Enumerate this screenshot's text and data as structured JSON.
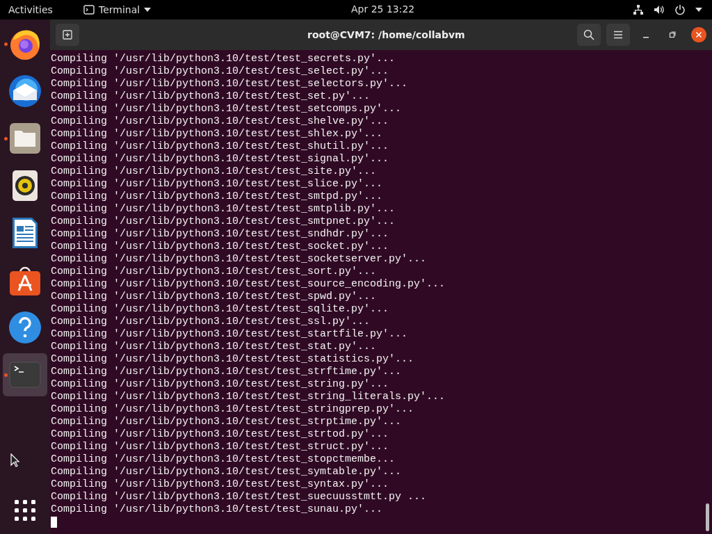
{
  "top_bar": {
    "activities": "Activities",
    "app_menu": "Terminal",
    "clock": "Apr 25  13:22"
  },
  "dock": {
    "items": [
      {
        "kind": "firefox",
        "running": true,
        "selected": false
      },
      {
        "kind": "thunderbird",
        "running": false,
        "selected": false
      },
      {
        "kind": "files",
        "running": true,
        "selected": false
      },
      {
        "kind": "rhythmbox",
        "running": false,
        "selected": false
      },
      {
        "kind": "writer",
        "running": false,
        "selected": false
      },
      {
        "kind": "software",
        "running": false,
        "selected": false
      },
      {
        "kind": "help",
        "running": false,
        "selected": false
      },
      {
        "kind": "terminal",
        "running": true,
        "selected": true
      }
    ]
  },
  "window": {
    "title": "root@CVM7: /home/collabvm"
  },
  "terminal": {
    "lines": [
      "Compiling '/usr/lib/python3.10/test/test_secrets.py'...",
      "Compiling '/usr/lib/python3.10/test/test_select.py'...",
      "Compiling '/usr/lib/python3.10/test/test_selectors.py'...",
      "Compiling '/usr/lib/python3.10/test/test_set.py'...",
      "Compiling '/usr/lib/python3.10/test/test_setcomps.py'...",
      "Compiling '/usr/lib/python3.10/test/test_shelve.py'...",
      "Compiling '/usr/lib/python3.10/test/test_shlex.py'...",
      "Compiling '/usr/lib/python3.10/test/test_shutil.py'...",
      "Compiling '/usr/lib/python3.10/test/test_signal.py'...",
      "Compiling '/usr/lib/python3.10/test/test_site.py'...",
      "Compiling '/usr/lib/python3.10/test/test_slice.py'...",
      "Compiling '/usr/lib/python3.10/test/test_smtpd.py'...",
      "Compiling '/usr/lib/python3.10/test/test_smtplib.py'...",
      "Compiling '/usr/lib/python3.10/test/test_smtpnet.py'...",
      "Compiling '/usr/lib/python3.10/test/test_sndhdr.py'...",
      "Compiling '/usr/lib/python3.10/test/test_socket.py'...",
      "Compiling '/usr/lib/python3.10/test/test_socketserver.py'...",
      "Compiling '/usr/lib/python3.10/test/test_sort.py'...",
      "Compiling '/usr/lib/python3.10/test/test_source_encoding.py'...",
      "Compiling '/usr/lib/python3.10/test/test_spwd.py'...",
      "Compiling '/usr/lib/python3.10/test/test_sqlite.py'...",
      "Compiling '/usr/lib/python3.10/test/test_ssl.py'...",
      "Compiling '/usr/lib/python3.10/test/test_startfile.py'...",
      "Compiling '/usr/lib/python3.10/test/test_stat.py'...",
      "Compiling '/usr/lib/python3.10/test/test_statistics.py'...",
      "Compiling '/usr/lib/python3.10/test/test_strftime.py'...",
      "Compiling '/usr/lib/python3.10/test/test_string.py'...",
      "Compiling '/usr/lib/python3.10/test/test_string_literals.py'...",
      "Compiling '/usr/lib/python3.10/test/test_stringprep.py'...",
      "Compiling '/usr/lib/python3.10/test/test_strptime.py'...",
      "Compiling '/usr/lib/python3.10/test/test_strtod.py'...",
      "Compiling '/usr/lib/python3.10/test/test_struct.py'...",
      "Compiling '/usr/lib/python3.10/test/test_stopctmembe...",
      "Compiling '/usr/lib/python3.10/test/test_symtable.py'...",
      "Compiling '/usr/lib/python3.10/test/test_syntax.py'...",
      "Compiling '/usr/lib/python3.10/test/test_suecuusstmtt.py ...",
      "Compiling '/usr/lib/python3.10/test/test_sunau.py'..."
    ]
  }
}
